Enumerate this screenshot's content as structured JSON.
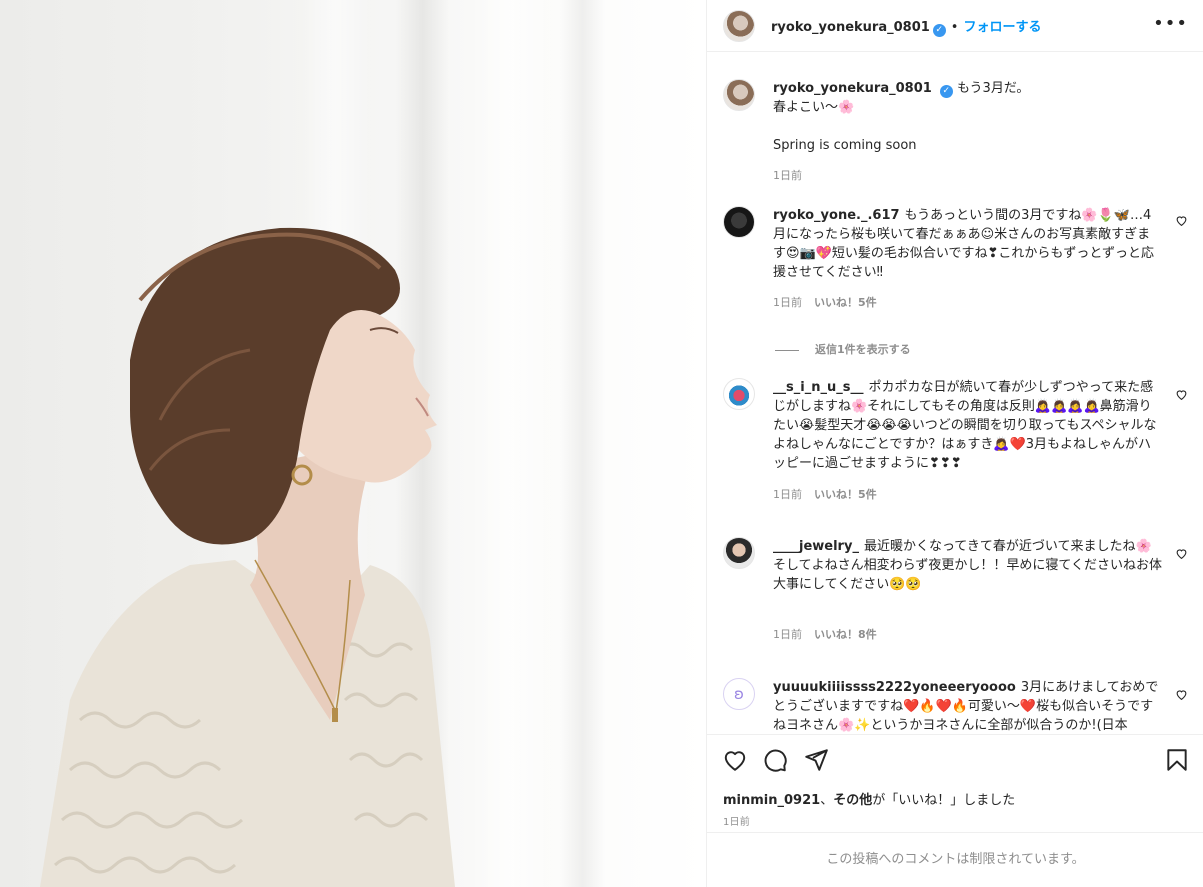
{
  "post": {
    "username": "ryoko_yonekura_0801",
    "follow_label": "フォローする",
    "separator": "•",
    "more_label": "•••",
    "caption_line1": "もう3月だ。",
    "caption_line2": "春よこい〜🌸",
    "caption_line3": "Spring is coming soon",
    "caption_time": "1日前"
  },
  "comments": [
    {
      "username": "ryoko_yone._.617",
      "text": "もうあっという間の3月ですね🌸🌷🦋…4月になったら桜も咲いて春だぁぁあ☺︎米さんのお写真素敵すぎます😍📷💖短い髪の毛お似合いですね❣これからもずっとずっと応援させてください‼︎",
      "time": "1日前",
      "likes": "いいね！5件",
      "replies": "返信1件を表示する"
    },
    {
      "username": "__s_i_n_u_s__",
      "text": "ポカポカな日が続いて春が少しずつやって来た感じがしますね🌸それにしてもその角度は反則🙇‍♀️🙇‍♀️🙇‍♀️🙇‍♀️鼻筋滑りたい😭髪型天才😭😭😭いつどの瞬間を切り取ってもスペシャルなよねしゃんなにごとですか？はぁすき🙇‍♀️❤️3月もよねしゃんがハッピーに過ごせますように❣❣❣",
      "time": "1日前",
      "likes": "いいね！5件"
    },
    {
      "username": "____jewelry_",
      "text": "最近暖かくなってきて春が近づいて来ましたね🌸そしてよねさん相変わらず夜更かし！！早めに寝てくださいねお体大事にしてください🥺🥺",
      "time": "1日前",
      "likes": "いいね！8件"
    },
    {
      "username": "yuuuukiiiissss2222yoneeeryoooo",
      "text": "3月にあけましておめでとうございますですね❤️🔥❤️🔥可愛い〜❤️桜も似合いそうですねヨネさん🌸✨というかヨネさんに全部が似合うのか!(日本",
      "time": "",
      "likes": ""
    }
  ],
  "footer": {
    "liked_by_user": "minmin_0921",
    "liked_by_sep": "、",
    "liked_by_others": "その他",
    "liked_by_suffix": "が「いいね！」しました",
    "date": "1日前",
    "restricted": "この投稿へのコメントは制限されています。"
  },
  "icons": {
    "like": "heart-icon",
    "comment": "comment-icon",
    "share": "share-icon",
    "save": "bookmark-icon",
    "verified": "verified-badge-icon"
  },
  "colors": {
    "accent": "#0095f6",
    "verified": "#3897f0",
    "muted": "#8e8e8e",
    "text": "#262626"
  }
}
